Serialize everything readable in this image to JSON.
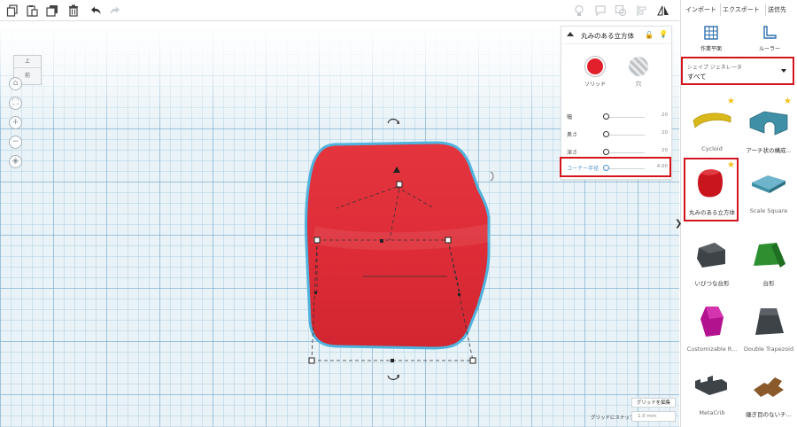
{
  "toolbar": {
    "icons": [
      "copy-icon",
      "paste-icon",
      "duplicate-icon",
      "delete-icon",
      "undo-icon",
      "redo-icon"
    ],
    "right_icons": [
      "light-icon",
      "notes-icon",
      "group-icon",
      "align-icon",
      "mirror-icon"
    ]
  },
  "library_header": {
    "import_label": "インポート",
    "export_label": "エクスポート",
    "send_label": "送信先"
  },
  "tools": {
    "workplane_label": "作業平面",
    "ruler_label": "ルーラー"
  },
  "viewcube": {
    "top_label": "上",
    "front_label": "前"
  },
  "inspector": {
    "title": "丸みのある立方体",
    "solid_label": "ソリッド",
    "hole_label": "穴",
    "params": [
      {
        "label": "幅",
        "value": "20"
      },
      {
        "label": "奥さ",
        "value": "20"
      },
      {
        "label": "深さ",
        "value": "20"
      },
      {
        "label": "コーナー半径",
        "value": "4.00"
      }
    ]
  },
  "shape_selector": {
    "caption": "シェイプ ジェネレータ",
    "value": "すべて"
  },
  "library_items": [
    {
      "label": "Cycloid",
      "starred": true
    },
    {
      "label": "アーチ状の構成...",
      "starred": true
    },
    {
      "label": "丸みのある立方体",
      "starred": true
    },
    {
      "label": "Scale Square",
      "starred": false
    },
    {
      "label": "いびつな台形",
      "starred": false
    },
    {
      "label": "台形",
      "starred": false
    },
    {
      "label": "Customizable R...",
      "starred": false
    },
    {
      "label": "Double Trapezoid",
      "starred": false
    },
    {
      "label": "MetaCrib",
      "starred": false
    },
    {
      "label": "継ぎ目のないチ...",
      "starred": false
    }
  ],
  "grid": {
    "edit_label": "グリッドを編集",
    "snap_label": "グリッドにスナップ",
    "snap_value": "1.0 mm"
  },
  "colors": {
    "shape_red": "#e1202b",
    "highlight": "#d4141c",
    "accent_blue": "#4a8fc9"
  }
}
